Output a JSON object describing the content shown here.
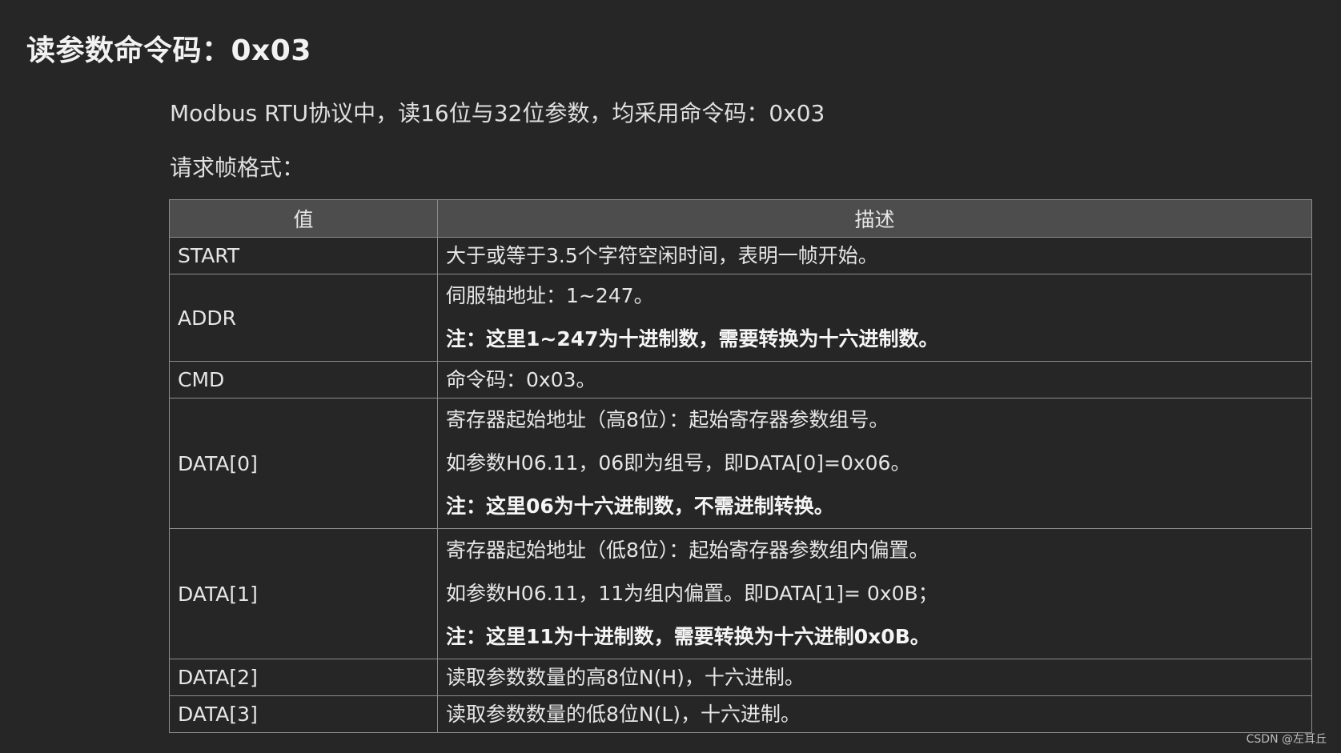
{
  "heading": "读参数命令码：0x03",
  "intro": "Modbus RTU协议中，读16位与32位参数，均采用命令码：0x03",
  "subheading": "请求帧格式：",
  "table": {
    "headers": [
      "值",
      "描述"
    ],
    "rows": [
      {
        "value": "START",
        "lines": [
          {
            "text": "大于或等于3.5个字符空闲时间，表明一帧开始。",
            "bold": false
          }
        ]
      },
      {
        "value": "ADDR",
        "lines": [
          {
            "text": "伺服轴地址：1~247。",
            "bold": false
          },
          {
            "text": "注：这里1~247为十进制数，需要转换为十六进制数。",
            "bold": true
          }
        ]
      },
      {
        "value": "CMD",
        "lines": [
          {
            "text": "命令码：0x03。",
            "bold": false
          }
        ]
      },
      {
        "value": "DATA[0]",
        "lines": [
          {
            "text": "寄存器起始地址（高8位）：起始寄存器参数组号。",
            "bold": false
          },
          {
            "text": "如参数H06.11，06即为组号，即DATA[0]=0x06。",
            "bold": false
          },
          {
            "text": "注：这里06为十六进制数，不需进制转换。",
            "bold": true
          }
        ]
      },
      {
        "value": "DATA[1]",
        "lines": [
          {
            "text": "寄存器起始地址（低8位）：起始寄存器参数组内偏置。",
            "bold": false
          },
          {
            "text": "如参数H06.11，11为组内偏置。即DATA[1]= 0x0B；",
            "bold": false
          },
          {
            "text": "注：这里11为十进制数，需要转换为十六进制0x0B。",
            "bold": true
          }
        ]
      },
      {
        "value": "DATA[2]",
        "lines": [
          {
            "text": "读取参数数量的高8位N(H)，十六进制。",
            "bold": false
          }
        ]
      },
      {
        "value": "DATA[3]",
        "lines": [
          {
            "text": "读取参数数量的低8位N(L)，十六进制。",
            "bold": false
          }
        ]
      }
    ]
  },
  "watermark": "CSDN @左耳丘"
}
